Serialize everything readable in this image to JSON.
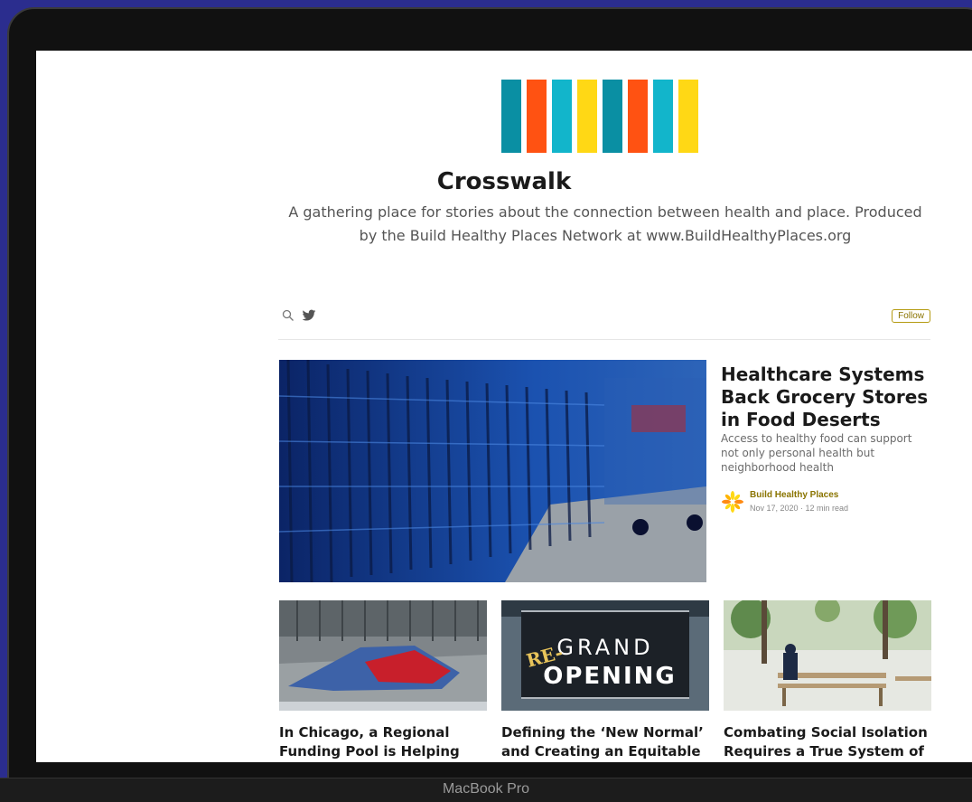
{
  "device": {
    "label": "MacBook Pro"
  },
  "publication": {
    "logo_colors": [
      "#0a8fa3",
      "#ff5212",
      "#12b5cb",
      "#ffd815",
      "#0a8fa3",
      "#ff5212",
      "#12b5cb",
      "#ffd815"
    ],
    "name": "Crosswalk",
    "description": "A gathering place for stories about the connection between health and place. Produced by the Build Healthy Places Network at www.BuildHealthyPlaces.org"
  },
  "toolbar": {
    "search_icon": "search-icon",
    "twitter_icon": "twitter-icon",
    "follow_label": "Follow"
  },
  "featured": {
    "title": "Healthcare Systems Back Grocery Stores in Food Deserts",
    "subtitle": "Access to healthy food can support not only personal health but neighborhood health",
    "author": "Build Healthy Places",
    "meta": "Nov 17, 2020 · 12 min read"
  },
  "cards": [
    {
      "title": "In Chicago, a Regional Funding Pool is Helping the Chronically"
    },
    {
      "title": "Defining the ‘New Normal’ and Creating an Equitable",
      "image_text_top": "GRAND",
      "image_text_bottom": "OPENING",
      "image_text_badge": "RE-"
    },
    {
      "title": "Combating Social Isolation Requires a True System of Care"
    }
  ],
  "colors": {
    "accent": "#8a7400",
    "bezel": "#111111",
    "background": "#2b2d8e"
  }
}
